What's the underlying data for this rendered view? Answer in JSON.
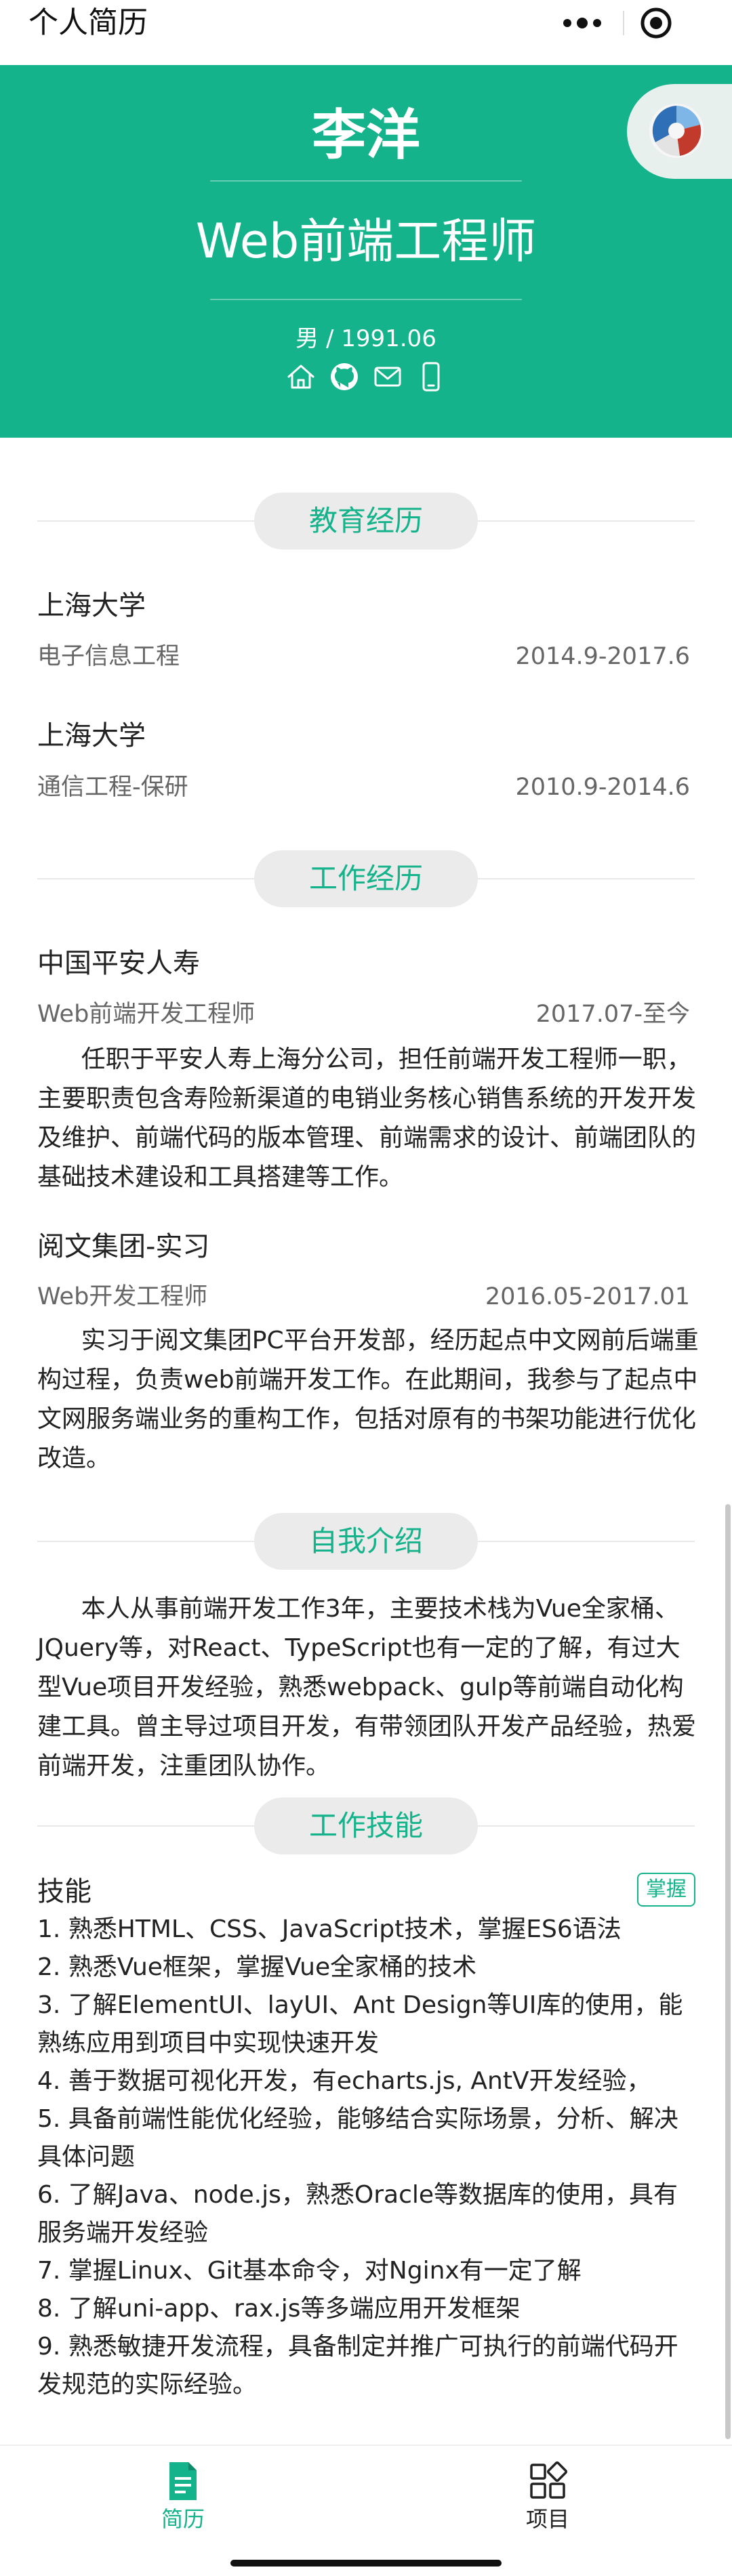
{
  "navbar": {
    "title": "个人简历"
  },
  "profile": {
    "name": "李洋",
    "job_title": "Web前端工程师",
    "meta": "男 / 1991.06",
    "contact_icons": [
      "home-icon",
      "github-icon",
      "mail-icon",
      "phone-icon"
    ]
  },
  "education": {
    "heading": "教育经历",
    "items": [
      {
        "school": "上海大学",
        "major": "电子信息工程",
        "period": "2014.9-2017.6"
      },
      {
        "school": "上海大学",
        "major": "通信工程-保研",
        "period": "2010.9-2014.6"
      }
    ]
  },
  "work": {
    "heading": "工作经历",
    "items": [
      {
        "company": "中国平安人寿",
        "role": "Web前端开发工程师",
        "period": "2017.07-至今",
        "description": "任职于平安人寿上海分公司，担任前端开发工程师一职，主要职责包含寿险新渠道的电销业务核心销售系统的开发开发及维护、前端代码的版本管理、前端需求的设计、前端团队的基础技术建设和工具搭建等工作。"
      },
      {
        "company": "阅文集团-实习",
        "role": "Web开发工程师",
        "period": "2016.05-2017.01",
        "description": "实习于阅文集团PC平台开发部，经历起点中文网前后端重构过程，负责web前端开发工作。在此期间，我参与了起点中文网服务端业务的重构工作，包括对原有的书架功能进行优化改造。"
      }
    ]
  },
  "intro": {
    "heading": "自我介绍",
    "text": "本人从事前端开发工作3年，主要技术栈为Vue全家桶、JQuery等，对React、TypeScript也有一定的了解，有过大型Vue项目开发经验，熟悉webpack、gulp等前端自动化构建工具。曾主导过项目开发，有带领团队开发产品经验，热爱前端开发，注重团队协作。"
  },
  "skills": {
    "heading": "工作技能",
    "title": "技能",
    "badge": "掌握",
    "items": [
      "1. 熟悉HTML、CSS、JavaScript技术，掌握ES6语法",
      "2. 熟悉Vue框架，掌握Vue全家桶的技术",
      "3. 了解ElementUI、layUI、Ant Design等UI库的使用，能熟练应用到项目中实现快速开发",
      "4. 善于数据可视化开发，有echarts.js, AntV开发经验，",
      "5. 具备前端性能优化经验，能够结合实际场景，分析、解决具体问题",
      "6. 了解Java、node.js，熟悉Oracle等数据库的使用，具有服务端开发经验",
      "7. 掌握Linux、Git基本命令，对Nginx有一定了解",
      "8. 了解uni-app、rax.js等多端应用开发框架",
      "9. 熟悉敏捷开发流程，具备制定并推广可执行的前端代码开发规范的实际经验。"
    ]
  },
  "tabbar": {
    "items": [
      {
        "label": "简历",
        "icon": "resume-icon",
        "active": true
      },
      {
        "label": "项目",
        "icon": "grid-icon",
        "active": false
      }
    ]
  },
  "colors": {
    "accent": "#14b38b",
    "header_bg": "#14b38b",
    "pill_bg": "#ebebeb"
  }
}
